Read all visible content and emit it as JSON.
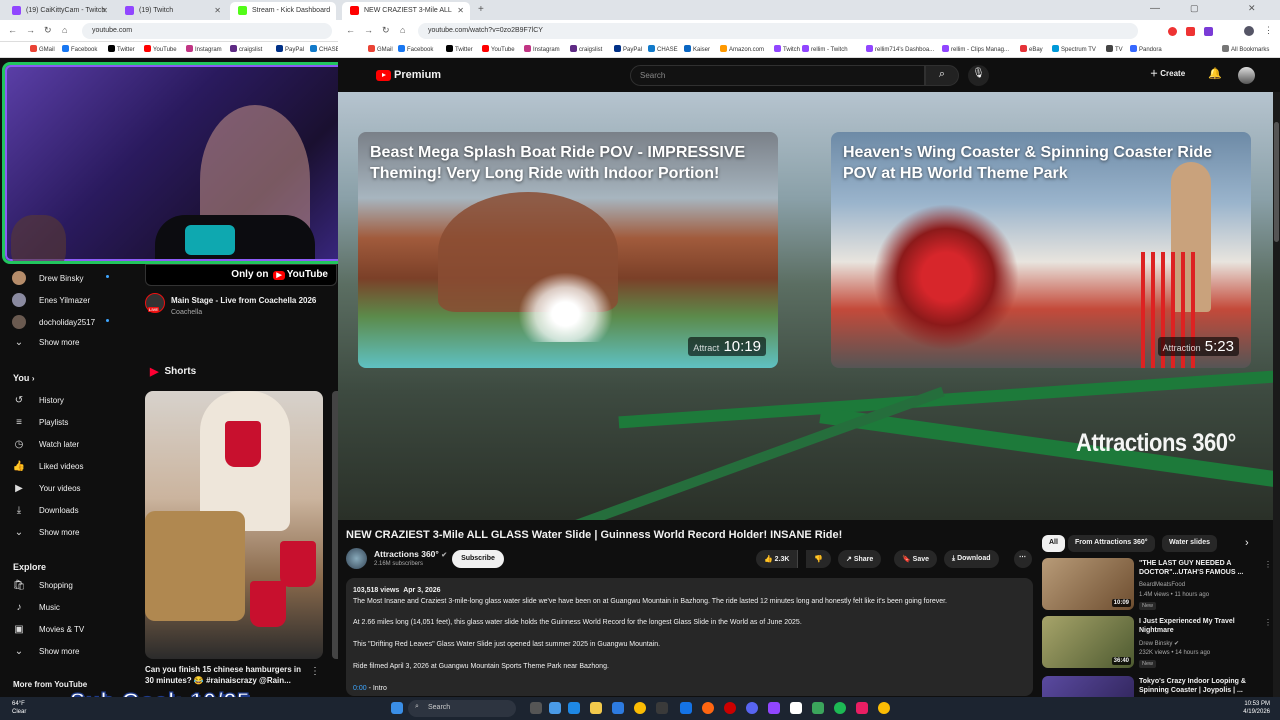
{
  "left_browser": {
    "tabs": [
      {
        "title": "(19) CaiKittyCam - Twitch",
        "color": "#9146ff"
      },
      {
        "title": "(19) Twitch",
        "color": "#9146ff"
      },
      {
        "title": "Stream - Kick Dashboard",
        "color": "#53fc18"
      }
    ],
    "url": "youtube.com",
    "bookmarks": [
      "GMail",
      "Facebook",
      "Twitter",
      "YouTube",
      "Instagram",
      "craigslist",
      "PayPal",
      "CHASE"
    ]
  },
  "right_browser": {
    "tab_title": "NEW CRAZIEST 3-Mile ALL",
    "url": "youtube.com/watch?v=0zo2B9F7lCY",
    "bookmarks": [
      "GMail",
      "Facebook",
      "Twitter",
      "YouTube",
      "Instagram",
      "craigslist",
      "PayPal",
      "CHASE",
      "Kaiser",
      "Amazon.com",
      "Twitch",
      "rellim - Twitch",
      "rellim714's Dashboa...",
      "rellim - Clips Manag...",
      "eBay",
      "Spectrum TV",
      "TV",
      "Pandora"
    ],
    "all_bookmarks": "All Bookmarks"
  },
  "left_sidebar": {
    "subscriptions": [
      {
        "name": "Drew Binsky",
        "dot": true
      },
      {
        "name": "Enes Yilmazer",
        "dot": false
      },
      {
        "name": "docholiday2517",
        "dot": true
      }
    ],
    "show_more_1": "Show more",
    "you_header": "You",
    "you_items": [
      {
        "label": "History",
        "icon": "history-icon"
      },
      {
        "label": "Playlists",
        "icon": "playlists-icon"
      },
      {
        "label": "Watch later",
        "icon": "watch-later-icon"
      },
      {
        "label": "Liked videos",
        "icon": "like-icon"
      },
      {
        "label": "Your videos",
        "icon": "your-videos-icon"
      },
      {
        "label": "Downloads",
        "icon": "download-icon"
      }
    ],
    "show_more_2": "Show more",
    "explore_header": "Explore",
    "explore_items": [
      {
        "label": "Shopping",
        "icon": "shopping-icon"
      },
      {
        "label": "Music",
        "icon": "music-icon"
      },
      {
        "label": "Movies & TV",
        "icon": "movies-icon"
      }
    ],
    "show_more_3": "Show more",
    "more_from": "More from YouTube"
  },
  "left_content": {
    "only_on": "Only on",
    "only_on_brand": "YouTube",
    "live_title": "Main Stage - Live from Coachella 2026",
    "live_channel": "Coachella",
    "live_badge": "LIVE",
    "shorts_header": "Shorts",
    "short_title": "Can you finish 15 chinese hamburgers in 30 minutes? 😂 #rainaiscrazy @Rain..."
  },
  "overlay": {
    "sub_goal": "Sub Goal: 10/25"
  },
  "header": {
    "logo": "Premium",
    "search_placeholder": "Search",
    "create": "Create"
  },
  "player": {
    "endcards": [
      {
        "title": "Beast Mega Splash Boat Ride POV - IMPRESSIVE Theming! Very Long Ride with Indoor Portion!",
        "duration": "10:19",
        "tag": "Attract"
      },
      {
        "title": "Heaven's Wing Coaster & Spinning Coaster Ride POV at HB World Theme Park",
        "duration": "5:23",
        "tag": "Attraction"
      }
    ],
    "watermark": "Attractions 360°"
  },
  "video": {
    "title": "NEW CRAZIEST 3-Mile ALL GLASS Water Slide | Guinness World Record Holder! INSANE Ride!",
    "channel": "Attractions 360°",
    "subscribers": "2.16M subscribers",
    "subscribe": "Subscribe",
    "likes": "2.3K",
    "share": "Share",
    "save": "Save",
    "download": "Download",
    "views": "103,518 views",
    "date": "Apr 3, 2026",
    "desc_lines": [
      "The Most Insane and Craziest 3-mile-long glass water slide we've have been on at Guangwu Mountain in Bazhong. The ride lasted 12 minutes long and honestly felt like it's been going forever.",
      "At 2.66 miles long (14,051 feet), this glass water slide holds the Guinness World Record for the longest Glass Slide in the World as of June 2025.",
      "This \"Drifting Red Leaves\" Glass Water Slide just opened last summer 2025 in Guangwu Mountain.",
      "Ride filmed April 3, 2026 at Guangwu Mountain Sports Theme Park near Bazhong."
    ],
    "chapter_time": "0:00",
    "chapter_label": "- Intro"
  },
  "recs": {
    "chips": [
      "All",
      "From Attractions 360°",
      "Water slides"
    ],
    "items": [
      {
        "title": "\"THE LAST GUY NEEDED A DOCTOR\"...UTAH'S FAMOUS ...",
        "channel": "BeardMeatsFood",
        "views": "1.4M views • 11 hours ago",
        "badge": "New",
        "duration": "10:09",
        "color": "#8c6a48"
      },
      {
        "title": "I Just Experienced My Travel Nightmare",
        "channel": "Drew Binsky",
        "views": "232K views • 14 hours ago",
        "badge": "New",
        "duration": "36:40",
        "color": "#6f7a4a"
      },
      {
        "title": "Tokyo's Crazy Indoor Looping & Spinning Coaster | Joypolis | ...",
        "channel": "",
        "views": "",
        "badge": "",
        "duration": "",
        "color": "#4a3a7a"
      }
    ]
  },
  "taskbar": {
    "temp": "64°F",
    "weather": "Clear",
    "search": "Search",
    "time": "10:53 PM",
    "date": "4/19/2026"
  }
}
